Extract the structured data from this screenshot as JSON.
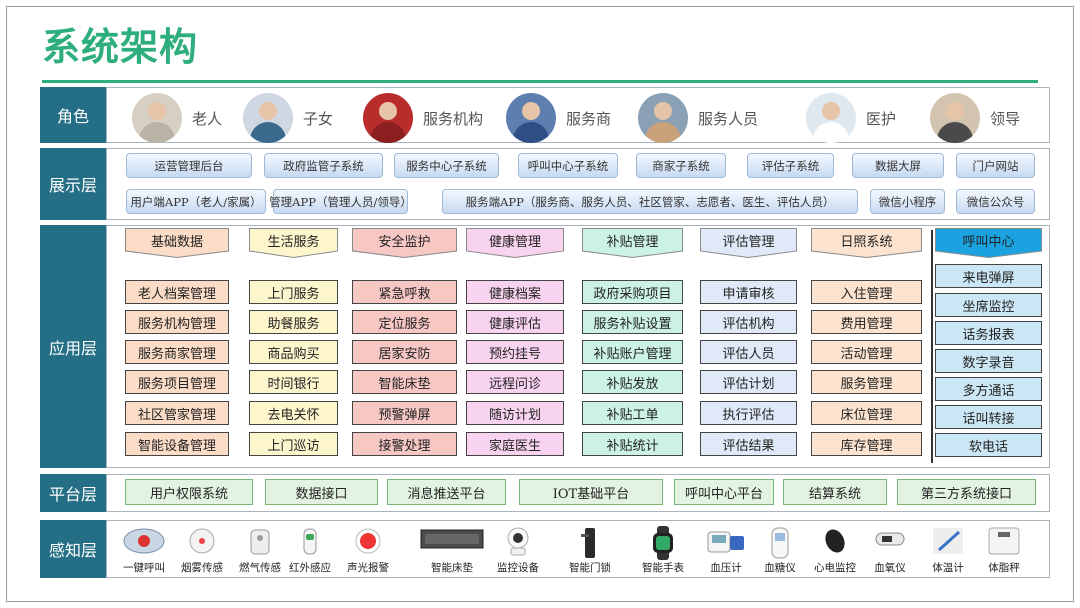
{
  "title": "系统架构",
  "layers": {
    "role": "角色",
    "display": "展示层",
    "application": "应用层",
    "platform": "平台层",
    "perception": "感知层"
  },
  "roles": [
    "老人",
    "子女",
    "服务机构",
    "服务商",
    "服务人员",
    "医护",
    "领导"
  ],
  "display_row1": [
    "运营管理后台",
    "政府监管子系统",
    "服务中心子系统",
    "呼叫中心子系统",
    "商家子系统",
    "评估子系统",
    "数据大屏",
    "门户网站"
  ],
  "display_row2": [
    "用户端APP（老人/家属）",
    "管理APP（管理人员/领导）",
    "服务端APP（服务商、服务人员、社区管家、志愿者、医生、评估人员）",
    "微信小程序",
    "微信公众号"
  ],
  "app_columns": [
    {
      "header": "基础数据",
      "color": "#fbdcc6",
      "items": [
        "老人档案管理",
        "服务机构管理",
        "服务商家管理",
        "服务项目管理",
        "社区管家管理",
        "智能设备管理"
      ]
    },
    {
      "header": "生活服务",
      "color": "#fdf5cc",
      "items": [
        "上门服务",
        "助餐服务",
        "商品购买",
        "时间银行",
        "去电关怀",
        "上门巡访"
      ]
    },
    {
      "header": "安全监护",
      "color": "#f7c7c4",
      "items": [
        "紧急呼救",
        "定位服务",
        "居家安防",
        "智能床垫",
        "预警弹屏",
        "接警处理"
      ]
    },
    {
      "header": "健康管理",
      "color": "#f8d3ef",
      "items": [
        "健康档案",
        "健康评估",
        "预约挂号",
        "远程问诊",
        "随访计划",
        "家庭医生"
      ]
    },
    {
      "header": "补贴管理",
      "color": "#ccf2e8",
      "items": [
        "政府采购项目",
        "服务补贴设置",
        "补贴账户管理",
        "补贴发放",
        "补贴工单",
        "补贴统计"
      ]
    },
    {
      "header": "评估管理",
      "color": "#dfe9f7",
      "items": [
        "申请审核",
        "评估机构",
        "评估人员",
        "评估计划",
        "执行评估",
        "评估结果"
      ]
    },
    {
      "header": "日照系统",
      "color": "#fbe3cf",
      "items": [
        "入住管理",
        "费用管理",
        "活动管理",
        "服务管理",
        "床位管理",
        "库存管理"
      ]
    },
    {
      "header": "呼叫中心",
      "color": "#cbe7f6",
      "items": [
        "来电弹屏",
        "坐席监控",
        "话务报表",
        "数字录音",
        "多方通话",
        "话叫转接",
        "软电话"
      ]
    }
  ],
  "platform": [
    "用户权限系统",
    "数据接口",
    "消息推送平台",
    "IOT基础平台",
    "呼叫中心平台",
    "结算系统",
    "第三方系统接口"
  ],
  "devices": [
    {
      "name": "一键呼叫",
      "icon": "emergency-call-icon"
    },
    {
      "name": "烟雾传感",
      "icon": "smoke-sensor-icon"
    },
    {
      "name": "燃气传感",
      "icon": "gas-sensor-icon"
    },
    {
      "name": "红外感应",
      "icon": "infrared-sensor-icon"
    },
    {
      "name": "声光报警",
      "icon": "alarm-icon"
    },
    {
      "name": "智能床垫",
      "icon": "smart-mattress-icon"
    },
    {
      "name": "监控设备",
      "icon": "camera-icon"
    },
    {
      "name": "智能门锁",
      "icon": "door-lock-icon"
    },
    {
      "name": "智能手表",
      "icon": "smart-watch-icon"
    },
    {
      "name": "血压计",
      "icon": "blood-pressure-icon"
    },
    {
      "name": "血糖仪",
      "icon": "glucometer-icon"
    },
    {
      "name": "心电监控",
      "icon": "ecg-monitor-icon"
    },
    {
      "name": "血氧仪",
      "icon": "oximeter-icon"
    },
    {
      "name": "体温计",
      "icon": "thermometer-icon"
    },
    {
      "name": "体脂秤",
      "icon": "body-fat-scale-icon"
    }
  ],
  "colors": {
    "title": "#2fae7d",
    "layer_label": "#246f86",
    "call_center_header": "#1aa3e0",
    "platform_fill": "#e3f3e1"
  }
}
